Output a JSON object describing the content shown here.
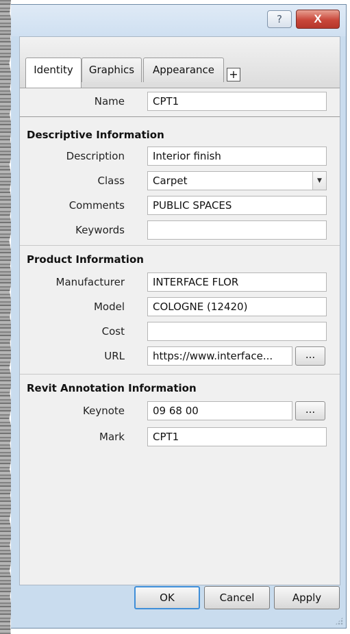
{
  "titlebar": {
    "help_label": "?",
    "close_label": "X"
  },
  "tabs": [
    {
      "label": "Identity"
    },
    {
      "label": "Graphics"
    },
    {
      "label": "Appearance"
    }
  ],
  "tab_add_label": "+",
  "name": {
    "label": "Name",
    "value": "CPT1"
  },
  "descriptive": {
    "title": "Descriptive Information",
    "description": {
      "label": "Description",
      "value": "Interior finish"
    },
    "class": {
      "label": "Class",
      "value": "Carpet"
    },
    "comments": {
      "label": "Comments",
      "value": "PUBLIC SPACES"
    },
    "keywords": {
      "label": "Keywords",
      "value": ""
    }
  },
  "product": {
    "title": "Product Information",
    "manufacturer": {
      "label": "Manufacturer",
      "value": "INTERFACE FLOR"
    },
    "model": {
      "label": "Model",
      "value": "COLOGNE (12420)"
    },
    "cost": {
      "label": "Cost",
      "value": ""
    },
    "url": {
      "label": "URL",
      "value": "https://www.interface...",
      "button": "..."
    }
  },
  "revit": {
    "title": "Revit Annotation Information",
    "keynote": {
      "label": "Keynote",
      "value": "09 68 00",
      "button": "..."
    },
    "mark": {
      "label": "Mark",
      "value": "CPT1"
    }
  },
  "footer": {
    "ok": "OK",
    "cancel": "Cancel",
    "apply": "Apply"
  }
}
